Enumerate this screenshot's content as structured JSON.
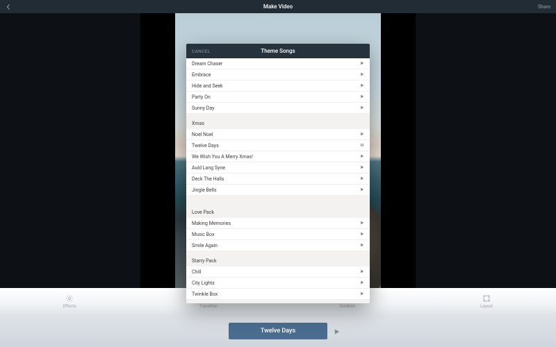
{
  "header": {
    "title": "Make Video",
    "share_label": "Share"
  },
  "toolbar": {
    "effects_label": "Effects",
    "transition_label": "Transition",
    "duration_label": "Duration",
    "layout_label": "Layout"
  },
  "playbar": {
    "now_playing": "Twelve Days"
  },
  "modal": {
    "title": "Theme Songs",
    "cancel_label": "CANCEL",
    "sections": [
      {
        "name": "",
        "songs": [
          {
            "title": "Dream Chaser",
            "state": "play"
          },
          {
            "title": "Embrace",
            "state": "play"
          },
          {
            "title": "Hide and Seek",
            "state": "play"
          },
          {
            "title": "Party On",
            "state": "play"
          },
          {
            "title": "Sunny Day",
            "state": "play"
          }
        ]
      },
      {
        "name": "Xmas",
        "songs": [
          {
            "title": "Noel Noel",
            "state": "play"
          },
          {
            "title": "Twelve Days",
            "state": "pause"
          },
          {
            "title": "We Wish You A Merry Xmas!",
            "state": "play"
          },
          {
            "title": "Auld Lang Syne",
            "state": "play"
          },
          {
            "title": "Deck The Halls",
            "state": "play"
          },
          {
            "title": "Jingle Bells",
            "state": "play"
          }
        ]
      },
      {
        "name": "Love Pack",
        "songs": [
          {
            "title": "Making Memories",
            "state": "play"
          },
          {
            "title": "Music Box",
            "state": "play"
          },
          {
            "title": "Smile Again",
            "state": "play"
          }
        ]
      },
      {
        "name": "Starry Pack",
        "songs": [
          {
            "title": "Chill",
            "state": "play"
          },
          {
            "title": "City Lights",
            "state": "play"
          },
          {
            "title": "Twinkle Box",
            "state": "play"
          }
        ]
      }
    ]
  }
}
